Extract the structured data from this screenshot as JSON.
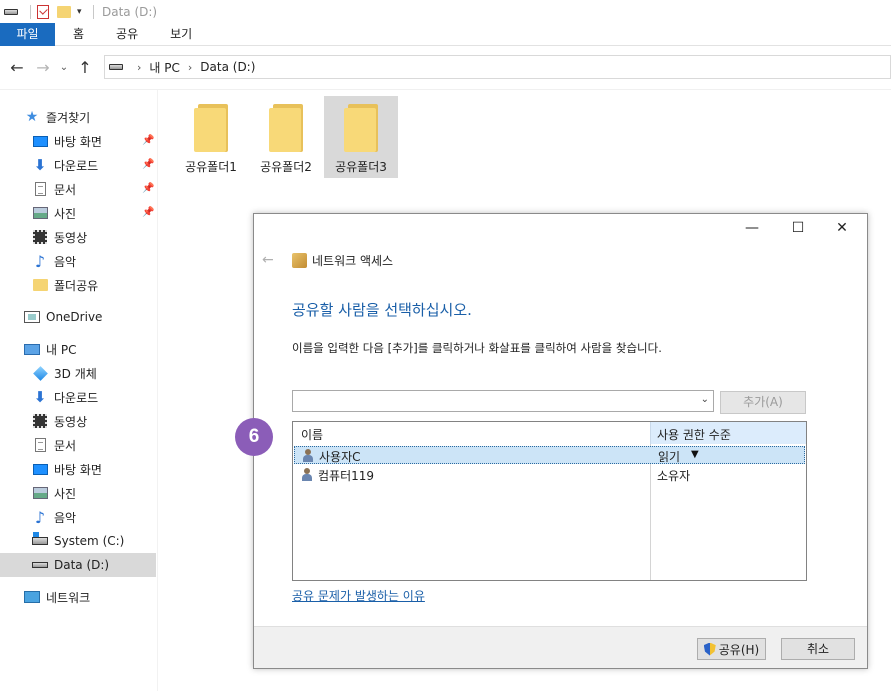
{
  "window": {
    "title": "Data (D:)"
  },
  "ribbon": {
    "tabs": [
      "파일",
      "홈",
      "공유",
      "보기"
    ]
  },
  "addressbar": {
    "crumbs": [
      "내 PC",
      "Data (D:)"
    ]
  },
  "sidebar": {
    "quick_access": "즐겨찾기",
    "quick_items": [
      {
        "label": "바탕 화면",
        "icon": "desktop-icon",
        "pinned": true
      },
      {
        "label": "다운로드",
        "icon": "download-arrow-icon",
        "pinned": true
      },
      {
        "label": "문서",
        "icon": "document-icon",
        "pinned": true
      },
      {
        "label": "사진",
        "icon": "picture-icon",
        "pinned": true
      },
      {
        "label": "동영상",
        "icon": "video-icon",
        "pinned": false
      },
      {
        "label": "음악",
        "icon": "music-note-icon",
        "pinned": false
      },
      {
        "label": "폴더공유",
        "icon": "folder-icon",
        "pinned": false
      }
    ],
    "onedrive": "OneDrive",
    "this_pc": "내 PC",
    "pc_items": [
      {
        "label": "3D 개체",
        "icon": "3d-objects-icon"
      },
      {
        "label": "다운로드",
        "icon": "download-arrow-icon"
      },
      {
        "label": "동영상",
        "icon": "video-icon"
      },
      {
        "label": "문서",
        "icon": "document-icon"
      },
      {
        "label": "바탕 화면",
        "icon": "desktop-icon"
      },
      {
        "label": "사진",
        "icon": "picture-icon"
      },
      {
        "label": "음악",
        "icon": "music-note-icon"
      },
      {
        "label": "System (C:)",
        "icon": "system-drive-icon"
      },
      {
        "label": "Data (D:)",
        "icon": "drive-icon",
        "selected": true
      }
    ],
    "network": "네트워크"
  },
  "folders": [
    {
      "label": "공유폴더1",
      "selected": false
    },
    {
      "label": "공유폴더2",
      "selected": false
    },
    {
      "label": "공유폴더3",
      "selected": true
    }
  ],
  "dialog": {
    "title": "네트워크 액세스",
    "heading": "공유할 사람을 선택하십시오.",
    "description": "이름을 입력한 다음 [추가]를 클릭하거나 화살표를 클릭하여 사람을 찾습니다.",
    "combo_value": "",
    "add_button": "추가(A)",
    "columns": {
      "name": "이름",
      "permission": "사용 권한 수준"
    },
    "rows": [
      {
        "name": "사용자C",
        "permission": "읽기",
        "selected": true
      },
      {
        "name": "컴퓨터119",
        "permission": "소유자",
        "selected": false
      }
    ],
    "help_link": "공유 문제가 발생하는 이유",
    "share_button": "공유(H)",
    "cancel_button": "취소"
  },
  "annotation": {
    "step": "6",
    "color": "#8b5db8"
  }
}
